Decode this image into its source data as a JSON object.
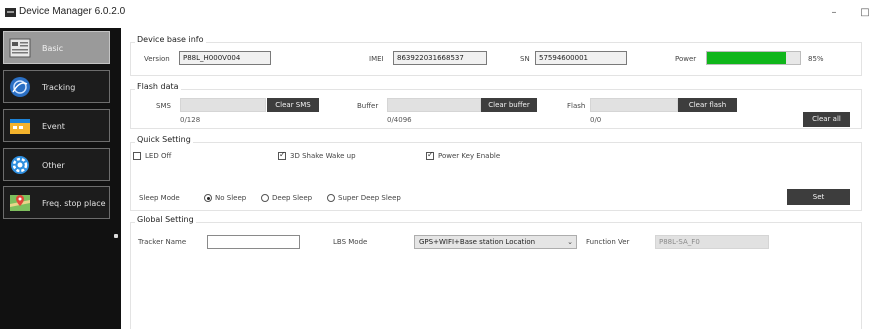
{
  "window": {
    "title": "Device Manager 6.0.2.0",
    "minimize": "–",
    "maximize": "□"
  },
  "sidebar": {
    "items": [
      {
        "label": "Basic",
        "icon": "basic-info-icon"
      },
      {
        "label": "Tracking",
        "icon": "tracking-icon"
      },
      {
        "label": "Event",
        "icon": "event-icon"
      },
      {
        "label": "Other",
        "icon": "gear-icon"
      },
      {
        "label": "Freq. stop place",
        "icon": "map-pin-icon"
      }
    ]
  },
  "base_info": {
    "title": "Device base info",
    "version_label": "Version",
    "version_value": "P88L_H000V004",
    "imei_label": "IMEI",
    "imei_value": "863922031668537",
    "sn_label": "SN",
    "sn_value": "57594600001",
    "power_label": "Power",
    "power_percent": 85,
    "power_text": "85%"
  },
  "flash_data": {
    "title": "Flash data",
    "sms_label": "SMS",
    "sms_count": "0/128",
    "clear_sms": "Clear SMS",
    "buffer_label": "Buffer",
    "buffer_count": "0/4096",
    "clear_buffer": "Clear buffer",
    "flash_label": "Flash",
    "flash_count": "0/0",
    "clear_flash": "Clear flash",
    "clear_all": "Clear all"
  },
  "quick_setting": {
    "title": "Quick Setting",
    "led_off": {
      "label": "LED Off",
      "checked": false
    },
    "shake_wake": {
      "label": "3D Shake Wake up",
      "checked": true
    },
    "power_key": {
      "label": "Power Key Enable",
      "checked": true
    },
    "sleep_mode_label": "Sleep Mode",
    "sleep_options": [
      {
        "label": "No Sleep",
        "selected": true
      },
      {
        "label": "Deep Sleep",
        "selected": false
      },
      {
        "label": "Super Deep Sleep",
        "selected": false
      }
    ],
    "set_button": "Set"
  },
  "global_setting": {
    "title": "Global Setting",
    "tracker_name_label": "Tracker Name",
    "tracker_name_value": "",
    "lbs_mode_label": "LBS Mode",
    "lbs_mode_value": "GPS+WIFI+Base station Location",
    "function_ver_label": "Function Ver",
    "function_ver_value": "P88L-SA_F0"
  },
  "colors": {
    "sidebar_bg": "#111111",
    "active_nav": "#9a9a9a",
    "power_bar": "#10b61b",
    "button": "#3d3d3d"
  }
}
